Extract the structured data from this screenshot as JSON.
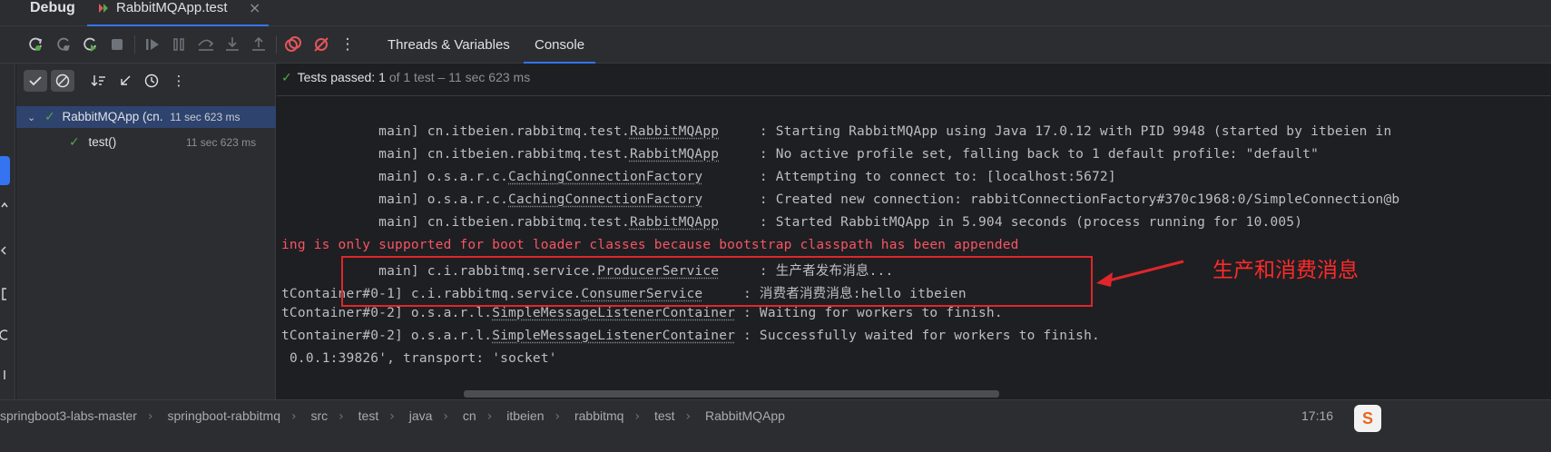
{
  "header": {
    "debug_label": "Debug",
    "run_tab_label": "RabbitMQApp.test",
    "close_glyph": "×"
  },
  "toolbar": {
    "tabs": [
      {
        "label": "Threads & Variables",
        "active": false
      },
      {
        "label": "Console",
        "active": true
      }
    ],
    "more_glyph": "⋮"
  },
  "test_tree": {
    "status_prefix": "Tests passed:",
    "status_count": "1",
    "status_detail": "of 1 test – 11 sec 623 ms",
    "root": {
      "label": "RabbitMQApp (cn.",
      "time": "11 sec 623 ms"
    },
    "child": {
      "label": "test()",
      "time": "11 sec 623 ms"
    }
  },
  "console": {
    "lines": [
      {
        "prefix": "            main] cn.itbeien.rabbitmq.test.",
        "cls": "RabbitMQApp",
        "suffix": "     : Starting RabbitMQApp using Java 17.0.12 with PID 9948 (started by itbeien in"
      },
      {
        "prefix": "            main] cn.itbeien.rabbitmq.test.",
        "cls": "RabbitMQApp",
        "suffix": "     : No active profile set, falling back to 1 default profile: \"default\""
      },
      {
        "prefix": "            main] o.s.a.r.c.",
        "cls": "CachingConnectionFactory",
        "suffix": "       : Attempting to connect to: [localhost:5672]"
      },
      {
        "prefix": "            main] o.s.a.r.c.",
        "cls": "CachingConnectionFactory",
        "suffix": "       : Created new connection: rabbitConnectionFactory#370c1968:0/SimpleConnection@b"
      },
      {
        "prefix": "            main] cn.itbeien.rabbitmq.test.",
        "cls": "RabbitMQApp",
        "suffix": "     : Started RabbitMQApp in 5.904 seconds (process running for 10.005)"
      },
      {
        "prefix": "ing is only supported for boot loader classes because bootstrap classpath has been appended",
        "cls": "",
        "suffix": "",
        "error": true
      },
      {
        "prefix": "            main] c.i.rabbitmq.service.",
        "cls": "ProducerService",
        "suffix": "     : 生产者发布消息..."
      },
      {
        "prefix": "tContainer#0-1] c.i.rabbitmq.service.",
        "cls": "ConsumerService",
        "suffix": "     : 消费者消费消息:hello itbeien"
      },
      {
        "prefix": "tContainer#0-2] o.s.a.r.l.",
        "cls": "SimpleMessageListenerContainer",
        "suffix": " : Waiting for workers to finish."
      },
      {
        "prefix": "tContainer#0-2] o.s.a.r.l.",
        "cls": "SimpleMessageListenerContainer",
        "suffix": " : Successfully waited for workers to finish."
      },
      {
        "prefix": "0.0.1:39826', transport: 'socket'",
        "cls": "",
        "suffix": ""
      }
    ],
    "annotation": "生产和消费消息"
  },
  "statusbar": {
    "breadcrumbs": [
      "springboot3-labs-master",
      "springboot-rabbitmq",
      "src",
      "test",
      "java",
      "cn",
      "itbeien",
      "rabbitmq",
      "test",
      "RabbitMQApp"
    ],
    "time": "17:16",
    "ime_label": "S"
  },
  "colors": {
    "accent": "#3574f0",
    "pass_green": "#57a64a",
    "error_red": "#f75464",
    "annotation_red": "#e0262b"
  },
  "icons": [
    "rerun-icon",
    "rerun-failed-icon",
    "restart-icon",
    "stop-icon",
    "resume-icon",
    "pause-icon",
    "step-over-icon",
    "step-into-icon",
    "step-out-icon",
    "view-breakpoints-icon",
    "mute-breakpoints-icon",
    "more-icon"
  ]
}
